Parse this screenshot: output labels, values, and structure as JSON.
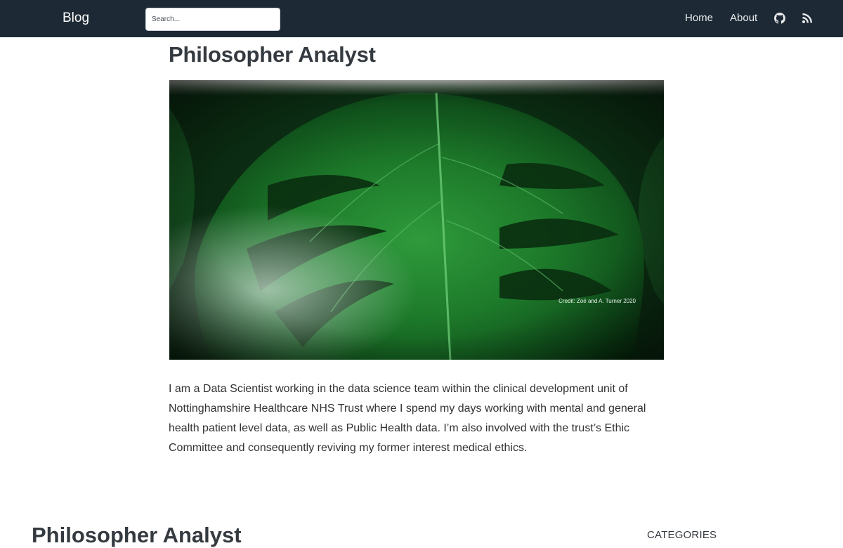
{
  "navbar": {
    "brand": "Blog",
    "search_placeholder": "Search...",
    "links": [
      {
        "label": "Home"
      },
      {
        "label": "About"
      }
    ],
    "icons": [
      "github-icon",
      "rss-icon"
    ],
    "background": "#1d2a35"
  },
  "about": {
    "title": "Philosopher Analyst",
    "image_credit": "Credit: Zoë and A. Turner 2020",
    "body": "I am a Data Scientist working in the data science team within the clinical development unit of Nottinghamshire Healthcare NHS Trust where I spend my days working with mental and general health patient level data, as well as Public Health data. I’m also involved with the trust’s Ethic Committee and consequently reviving my former interest medical ethics."
  },
  "listing": {
    "title": "Philosopher Analyst",
    "categories_heading": "CATEGORIES"
  }
}
